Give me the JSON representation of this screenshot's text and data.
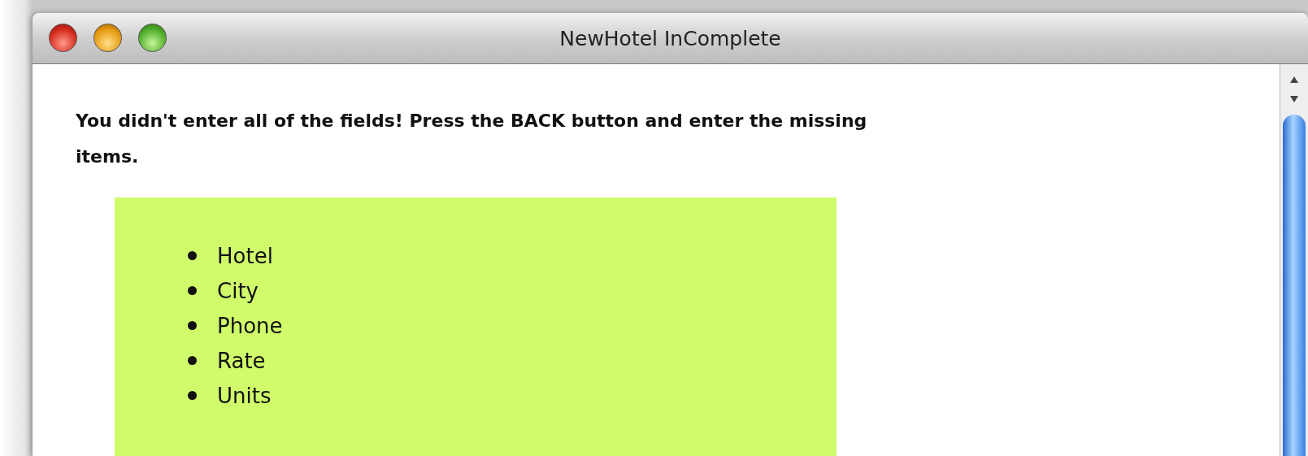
{
  "window": {
    "title": "NewHotel InComplete"
  },
  "message": "You didn't enter all of the fields! Press the BACK button and enter the missing items.",
  "missing_items": [
    "Hotel",
    "City",
    "Phone",
    "Rate",
    "Units"
  ]
}
